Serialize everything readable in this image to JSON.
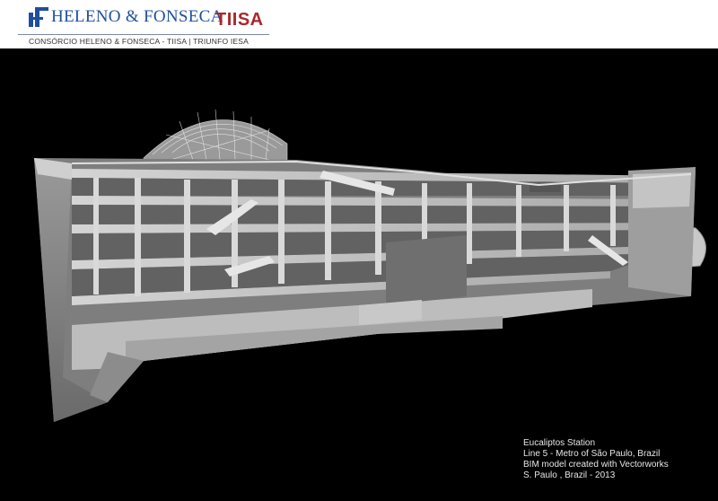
{
  "header": {
    "brand_heleno": "HELENO & FONSECA",
    "brand_tiisa": "TIISA",
    "consortium": "CONSÓRCIO HELENO & FONSECA - TIISA | TRIUNFO IESA"
  },
  "caption": {
    "line1": "Eucaliptos Station",
    "line2": "Line 5 - Metro of São Paulo, Brazil",
    "line3": "BIM model created with Vectorworks",
    "line4": "S. Paulo , Brazil - 2013"
  },
  "colors": {
    "header_blue": "#1e4f9c",
    "header_red": "#a8282c",
    "background": "#000000"
  }
}
